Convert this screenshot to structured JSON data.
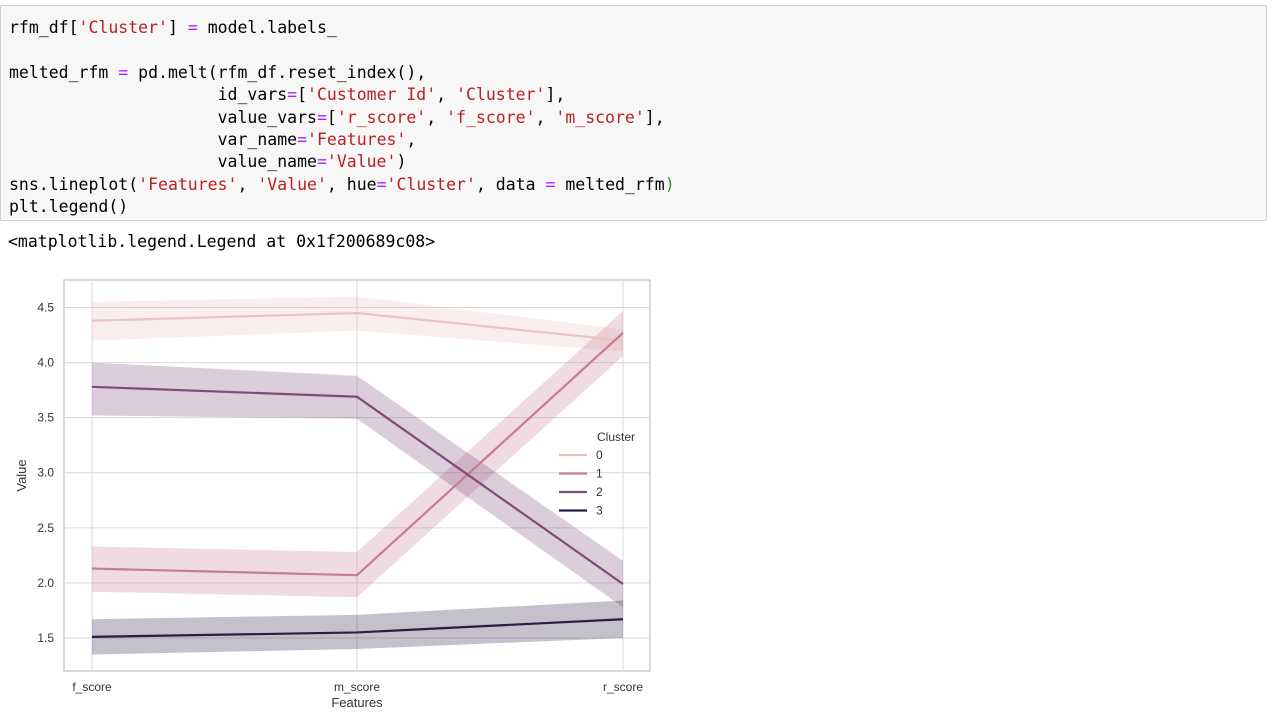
{
  "code_cell": {
    "lines": [
      [
        {
          "t": "rfm_df[",
          "c": ""
        },
        {
          "t": "'Cluster'",
          "c": "str"
        },
        {
          "t": "] ",
          "c": ""
        },
        {
          "t": "=",
          "c": "kw"
        },
        {
          "t": " model.labels_",
          "c": ""
        }
      ],
      [],
      [
        {
          "t": "melted_rfm ",
          "c": ""
        },
        {
          "t": "=",
          "c": "kw"
        },
        {
          "t": " pd.melt(rfm_df.reset_index(),",
          "c": ""
        }
      ],
      [
        {
          "t": "                     id_vars",
          "c": ""
        },
        {
          "t": "=",
          "c": "kw"
        },
        {
          "t": "[",
          "c": ""
        },
        {
          "t": "'Customer Id'",
          "c": "str"
        },
        {
          "t": ", ",
          "c": ""
        },
        {
          "t": "'Cluster'",
          "c": "str"
        },
        {
          "t": "],",
          "c": ""
        }
      ],
      [
        {
          "t": "                     value_vars",
          "c": ""
        },
        {
          "t": "=",
          "c": "kw"
        },
        {
          "t": "[",
          "c": ""
        },
        {
          "t": "'r_score'",
          "c": "str"
        },
        {
          "t": ", ",
          "c": ""
        },
        {
          "t": "'f_score'",
          "c": "str"
        },
        {
          "t": ", ",
          "c": ""
        },
        {
          "t": "'m_score'",
          "c": "str"
        },
        {
          "t": "],",
          "c": ""
        }
      ],
      [
        {
          "t": "                     var_name",
          "c": ""
        },
        {
          "t": "=",
          "c": "kw"
        },
        {
          "t": "'Features'",
          "c": "str"
        },
        {
          "t": ",",
          "c": ""
        }
      ],
      [
        {
          "t": "                     value_name",
          "c": ""
        },
        {
          "t": "=",
          "c": "kw"
        },
        {
          "t": "'Value'",
          "c": "str"
        },
        {
          "t": ")",
          "c": ""
        }
      ],
      [
        {
          "t": "sns.lineplot(",
          "c": ""
        },
        {
          "t": "'Features'",
          "c": "str"
        },
        {
          "t": ", ",
          "c": ""
        },
        {
          "t": "'Value'",
          "c": "str"
        },
        {
          "t": ", hue",
          "c": ""
        },
        {
          "t": "=",
          "c": "kw"
        },
        {
          "t": "'Cluster'",
          "c": "str"
        },
        {
          "t": ", data ",
          "c": ""
        },
        {
          "t": "=",
          "c": "kw"
        },
        {
          "t": " melted_rfm",
          "c": ""
        },
        {
          "t": ")",
          "c": "green"
        }
      ],
      [
        {
          "t": "plt.legend()",
          "c": ""
        }
      ]
    ]
  },
  "output": {
    "text": "<matplotlib.legend.Legend at 0x1f200689c08>"
  },
  "chart_data": {
    "type": "line",
    "x": [
      "f_score",
      "m_score",
      "r_score"
    ],
    "xlabel": "Features",
    "ylabel": "Value",
    "ylim": [
      1.2,
      4.75
    ],
    "yticks": [
      1.5,
      2.0,
      2.5,
      3.0,
      3.5,
      4.0,
      4.5
    ],
    "ytick_labels": [
      "1.5",
      "2.0",
      "2.5",
      "3.0",
      "3.5",
      "4.0",
      "4.5"
    ],
    "grid": true,
    "legend": {
      "title": "Cluster",
      "placement": "center-right"
    },
    "series": [
      {
        "name": "0",
        "color": "#e8c3c0",
        "values": [
          4.38,
          4.45,
          4.2
        ],
        "ci_low": [
          4.2,
          4.29,
          4.1
        ],
        "ci_high": [
          4.55,
          4.6,
          4.3
        ]
      },
      {
        "name": "1",
        "color": "#c57d93",
        "values": [
          2.13,
          2.07,
          4.27
        ],
        "ci_low": [
          1.92,
          1.87,
          4.06
        ],
        "ci_high": [
          2.33,
          2.28,
          4.47
        ]
      },
      {
        "name": "2",
        "color": "#7f4b7c",
        "values": [
          3.78,
          3.69,
          1.99
        ],
        "ci_low": [
          3.52,
          3.49,
          1.78
        ],
        "ci_high": [
          4.0,
          3.88,
          2.2
        ]
      },
      {
        "name": "3",
        "color": "#2c1d48",
        "values": [
          1.51,
          1.55,
          1.67
        ],
        "ci_low": [
          1.35,
          1.4,
          1.5
        ],
        "ci_high": [
          1.67,
          1.71,
          1.84
        ]
      }
    ]
  }
}
